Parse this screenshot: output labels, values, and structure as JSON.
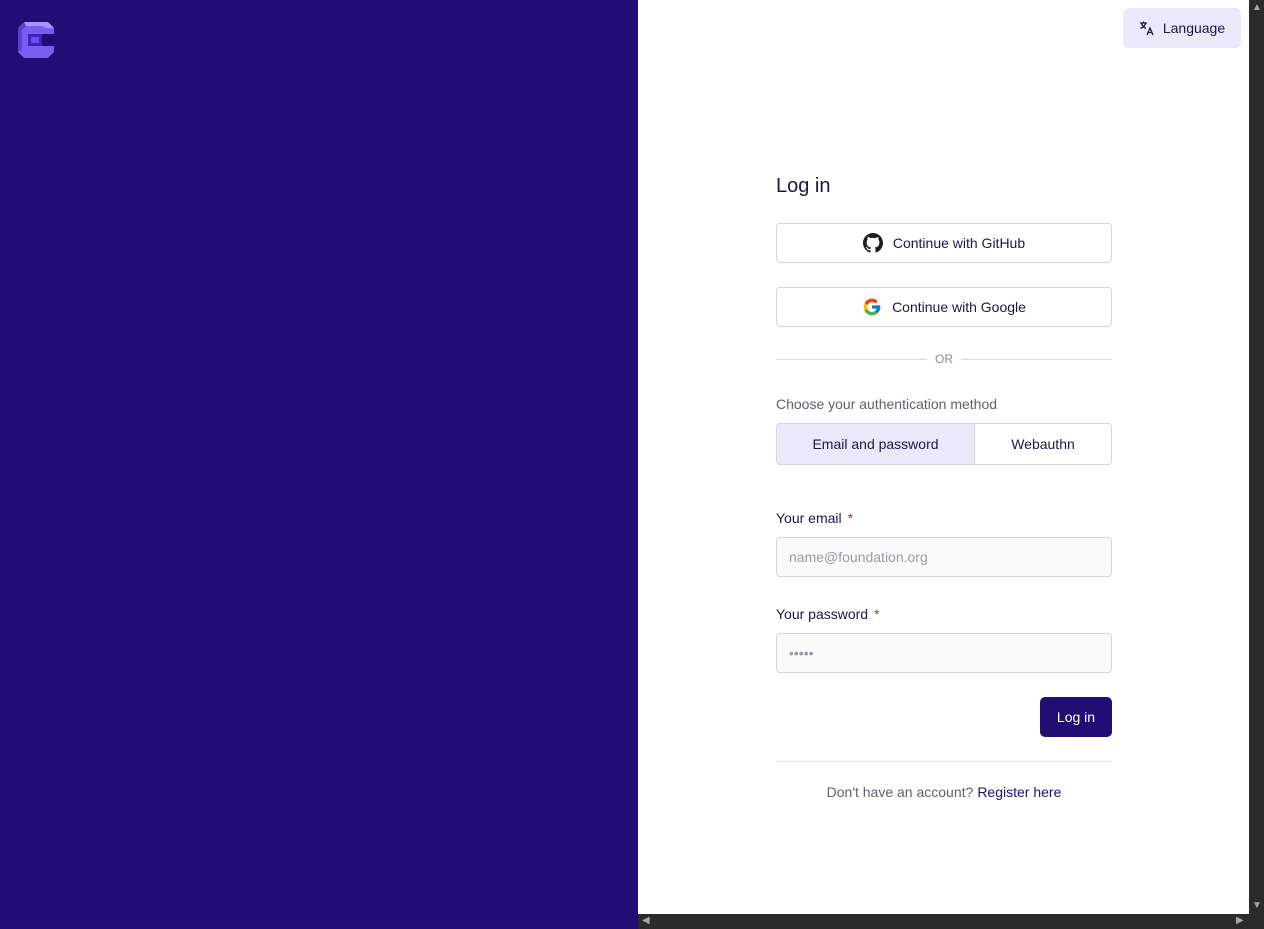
{
  "header": {
    "language_label": "Language"
  },
  "login": {
    "title": "Log in",
    "github_label": "Continue with GitHub",
    "google_label": "Continue with Google",
    "or_label": "OR",
    "method_label": "Choose your authentication method",
    "methods": [
      "Email and password",
      "Webauthn"
    ],
    "selected_method": "Email and password",
    "email_label": "Your email",
    "email_placeholder": "name@foundation.org",
    "email_value": "",
    "password_label": "Your password",
    "password_placeholder": "•••••",
    "required_mark": "*",
    "submit_label": "Log in",
    "register_prompt": "Don't have an account?",
    "register_link": "Register here"
  },
  "colors": {
    "brand": "#200e74",
    "accent_bg": "#ebe8fb",
    "required": "#d1263c"
  },
  "icons": {
    "logo": "brand-logo-icon",
    "language": "translate-icon",
    "github": "github-icon",
    "google": "google-icon"
  }
}
